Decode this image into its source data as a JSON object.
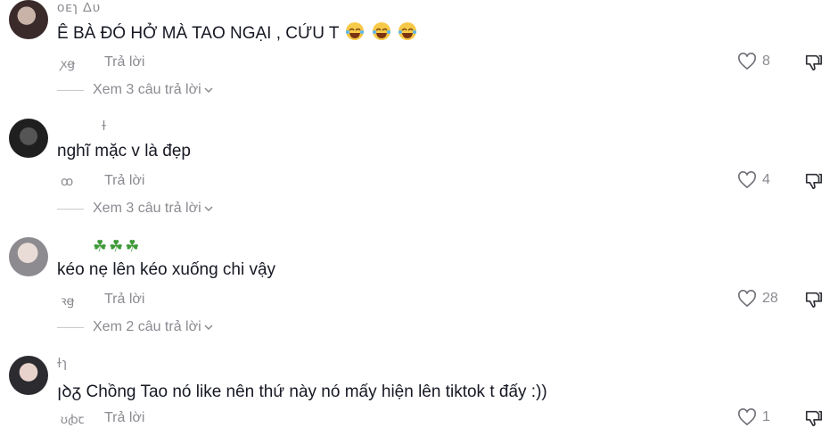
{
  "comments": [
    {
      "username": "ᴏᴇɿ Δᴜ",
      "text": "Ê BÀ ĐÓ HỞ MÀ TAO NGẠI , CỨU T",
      "emojis": [
        "laughing-tears",
        "laughing-tears",
        "laughing-tears"
      ],
      "time": "ꭗꞡ",
      "reply_label": "Trả lời",
      "likes": "8",
      "view_replies": "Xem 3 câu trả lời"
    },
    {
      "username": "ɫ",
      "text": "nghĩ mặc v là đẹp",
      "time": "ꝏ",
      "reply_label": "Trả lời",
      "likes": "4",
      "view_replies": "Xem 3 câu trả lời"
    },
    {
      "username": "☘☘☘",
      "text": "kéo nẹ lên kéo xuống chi vậy",
      "time": "ꝛꞡ",
      "reply_label": "Trả lời",
      "likes": "28",
      "view_replies": "Xem 2 câu trả lời"
    },
    {
      "username": "ɫɿ",
      "text": "ꞁꝺᵹ Chồng Tao nó like nên thứ này nó mấy hiện lên tiktok t đấy :))",
      "time": "ʊꞗꞇ",
      "reply_label": "Trả lời",
      "likes": "1"
    }
  ],
  "colors": {
    "text": "#161823",
    "secondary": "#8a8b91",
    "background": "#ffffff"
  },
  "icons": {
    "like": "heart-outline-icon",
    "dislike": "thumbs-down-icon",
    "expand": "chevron-down-icon",
    "emoji": "laughing-tears-emoji-icon"
  }
}
